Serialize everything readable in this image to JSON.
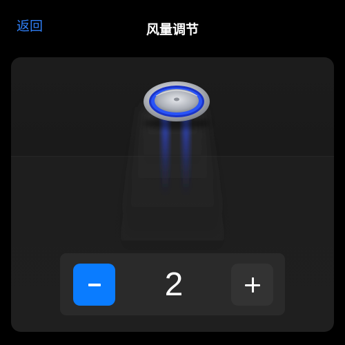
{
  "header": {
    "back_label": "返回",
    "title": "风量调节"
  },
  "fan_control": {
    "speed_value": "2",
    "accent_color": "#0a7cff"
  },
  "icons": {
    "fan": "fan-dome-icon",
    "decrease": "minus-icon",
    "increase": "plus-icon"
  }
}
